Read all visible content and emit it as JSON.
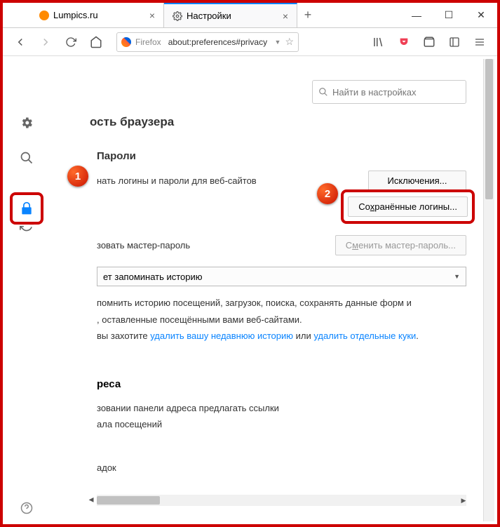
{
  "titlebar": {
    "tabs": [
      {
        "label": "Lumpics.ru",
        "favColor": "#ff8a00"
      },
      {
        "label": "Настройки"
      }
    ]
  },
  "urlbar": {
    "product": "Firefox",
    "address": "about:preferences#privacy"
  },
  "search": {
    "placeholder": "Найти в настройках"
  },
  "sidebar": {
    "items": [
      "general",
      "search",
      "privacy",
      "sync"
    ]
  },
  "content": {
    "section_title": "ость браузера",
    "passwords": {
      "heading": "Пароли",
      "remember_label": "нать логины и пароли для веб-сайтов",
      "exceptions_btn": "Исключения...",
      "saved_btn": {
        "pre": "Со",
        "u": "х",
        "post": "ранённые логины..."
      },
      "master_label": "зовать мастер-пароль",
      "change_master_btn": {
        "pre": "С",
        "u": "м",
        "post": "енить мастер-пароль..."
      }
    },
    "history": {
      "dropdown": "ет запоминать историю",
      "line1": "помнить историю посещений, загрузок, поиска, сохранять данные форм и",
      "line2": ", оставленные посещёнными вами веб-сайтами.",
      "line3_pre": "вы захотите ",
      "link1": "удалить вашу недавнюю историю",
      "line3_mid": " или ",
      "link2": "удалить отдельные куки",
      "line3_end": "."
    },
    "address": {
      "heading": "реса",
      "line1": "зовании панели адреса предлагать ссылки",
      "line2": "ала посещений",
      "line3": "адок"
    }
  },
  "annotations": {
    "one": "1",
    "two": "2"
  }
}
